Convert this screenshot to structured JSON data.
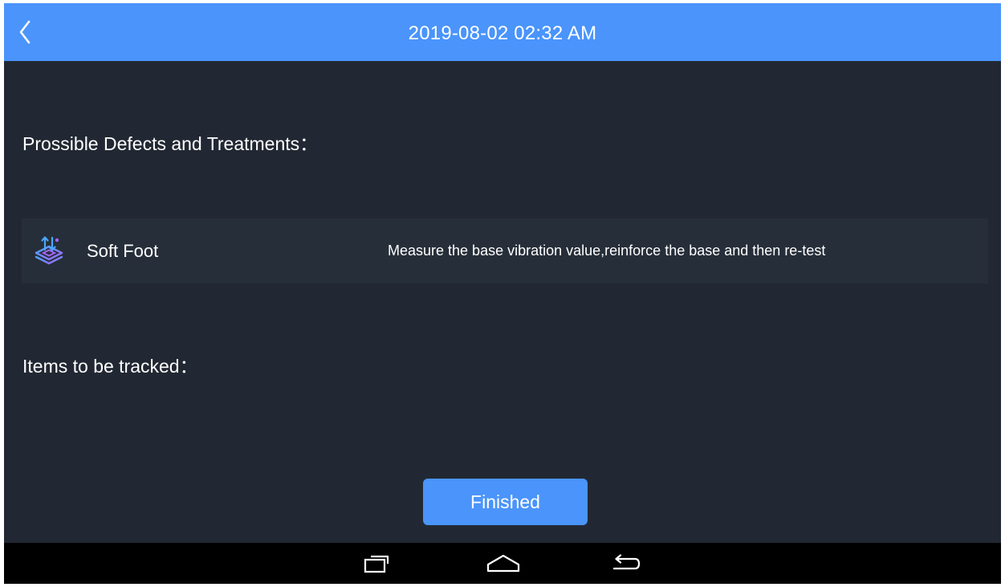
{
  "header": {
    "title": "2019-08-02 02:32 AM",
    "back_icon": "chevron-left-icon"
  },
  "defects_section": {
    "title": "Prossible Defects and Treatments：",
    "items": [
      {
        "icon": "soft-foot-icon",
        "name": "Soft Foot",
        "treatment": "Measure the base vibration value,reinforce the base and then re-test"
      }
    ]
  },
  "tracked_section": {
    "title": "Items to be tracked："
  },
  "finished_button": {
    "label": "Finished"
  },
  "nav_bar": {
    "recents_icon": "recents-icon",
    "home_icon": "home-icon",
    "back_icon": "back-arrow-icon"
  },
  "colors": {
    "header": "#4a94fb",
    "background": "#222833",
    "row_background": "#262e39",
    "button": "#4a94fb",
    "nav_bar": "#000000"
  }
}
